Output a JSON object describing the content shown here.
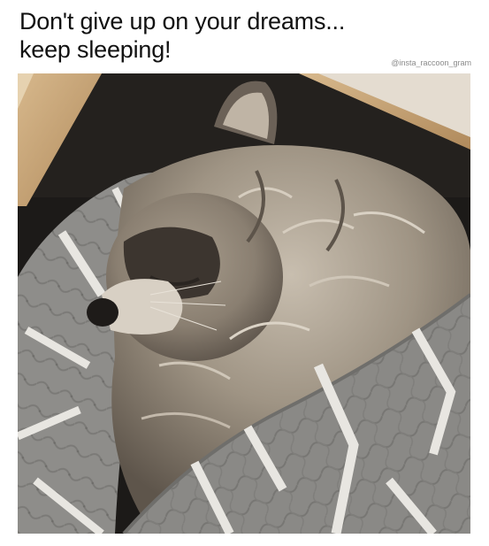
{
  "meme": {
    "caption_line1": "Don't give up on your dreams...",
    "caption_line2": "keep sleeping!",
    "watermark": "@insta_raccoon_gram"
  },
  "photo": {
    "subject": "sleeping raccoon wrapped in grey quilted blanket",
    "colors": {
      "background_dark": "#1c1a18",
      "wood": "#c9a77a",
      "fur_light": "#bdb3a4",
      "fur_mid": "#8d8274",
      "fur_dark": "#4a433b",
      "blanket_grey": "#8e8d8a",
      "blanket_stripe": "#e8e6e1"
    }
  }
}
